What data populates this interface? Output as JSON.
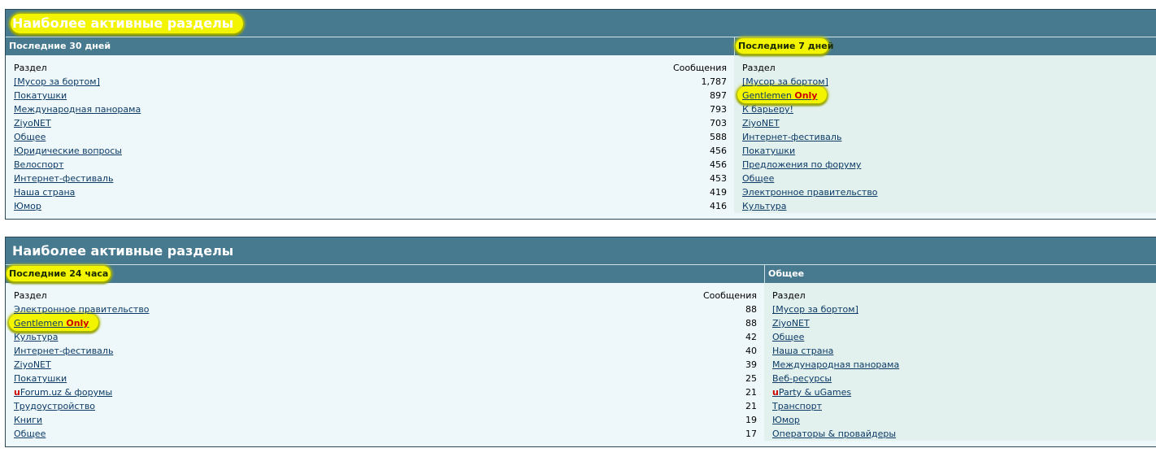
{
  "colors": {
    "header_bg": "#477a8f",
    "left_body_bg": "#eef8fa",
    "right_body_bg": "#e2f0ee",
    "link": "#0d3b66",
    "highlight": "#f3f500",
    "accent_red": "#cc0000"
  },
  "panels": [
    {
      "title": "Наиболее активные разделы",
      "left": {
        "header": "Последние 30 дней",
        "col_name": "Раздел",
        "col_count": "Сообщения",
        "rows": [
          {
            "prefix": "",
            "name": "[Мусор за бортом]",
            "suffix": "",
            "count": "1,787"
          },
          {
            "prefix": "",
            "name": "Покатушки",
            "suffix": "",
            "count": "897"
          },
          {
            "prefix": "",
            "name": "Международная панорама",
            "suffix": "",
            "count": "793"
          },
          {
            "prefix": "",
            "name": "ZiyoNET",
            "suffix": "",
            "count": "703"
          },
          {
            "prefix": "",
            "name": "Общее",
            "suffix": "",
            "count": "588"
          },
          {
            "prefix": "",
            "name": "Юридические вопросы",
            "suffix": "",
            "count": "456"
          },
          {
            "prefix": "",
            "name": "Велоспорт",
            "suffix": "",
            "count": "456"
          },
          {
            "prefix": "",
            "name": "Интернет-фестиваль",
            "suffix": "",
            "count": "453"
          },
          {
            "prefix": "",
            "name": "Наша страна",
            "suffix": "",
            "count": "419"
          },
          {
            "prefix": "",
            "name": "Юмор",
            "suffix": "",
            "count": "416"
          }
        ]
      },
      "right": {
        "header": "Последние 7 дней",
        "col_name": "Раздел",
        "rows": [
          {
            "prefix": "",
            "name": "[Мусор за бортом]",
            "suffix": ""
          },
          {
            "prefix": "",
            "name": "Gentlemen ",
            "suffix": "Only"
          },
          {
            "prefix": "",
            "name": "К барьеру!",
            "suffix": ""
          },
          {
            "prefix": "",
            "name": "ZiyoNET",
            "suffix": ""
          },
          {
            "prefix": "",
            "name": "Интернет-фестиваль",
            "suffix": ""
          },
          {
            "prefix": "",
            "name": "Покатушки",
            "suffix": ""
          },
          {
            "prefix": "",
            "name": "Предложения по форуму",
            "suffix": ""
          },
          {
            "prefix": "",
            "name": "Общее",
            "suffix": ""
          },
          {
            "prefix": "",
            "name": "Электронное правительство",
            "suffix": ""
          },
          {
            "prefix": "",
            "name": "Культура",
            "suffix": ""
          }
        ]
      }
    },
    {
      "title": "Наиболее активные разделы",
      "left": {
        "header": "Последние 24 часа",
        "col_name": "Раздел",
        "col_count": "Сообщения",
        "rows": [
          {
            "prefix": "",
            "name": "Электронное правительство",
            "suffix": "",
            "count": "88"
          },
          {
            "prefix": "",
            "name": "Gentlemen ",
            "suffix": "Only",
            "count": "88"
          },
          {
            "prefix": "",
            "name": "Культура",
            "suffix": "",
            "count": "42"
          },
          {
            "prefix": "",
            "name": "Интернет-фестиваль",
            "suffix": "",
            "count": "40"
          },
          {
            "prefix": "",
            "name": "ZiyoNET",
            "suffix": "",
            "count": "39"
          },
          {
            "prefix": "",
            "name": "Покатушки",
            "suffix": "",
            "count": "25"
          },
          {
            "prefix": "u",
            "name": "Forum.uz & форумы",
            "suffix": "",
            "count": "21"
          },
          {
            "prefix": "",
            "name": "Трудоустройство",
            "suffix": "",
            "count": "21"
          },
          {
            "prefix": "",
            "name": "Книги",
            "suffix": "",
            "count": "19"
          },
          {
            "prefix": "",
            "name": "Общее",
            "suffix": "",
            "count": "17"
          }
        ]
      },
      "right": {
        "header": "Общее",
        "col_name": "Раздел",
        "rows": [
          {
            "prefix": "",
            "name": "[Мусор за бортом]",
            "suffix": ""
          },
          {
            "prefix": "",
            "name": "ZiyoNET",
            "suffix": ""
          },
          {
            "prefix": "",
            "name": "Общее",
            "suffix": ""
          },
          {
            "prefix": "",
            "name": "Наша страна",
            "suffix": ""
          },
          {
            "prefix": "",
            "name": "Международная панорама",
            "suffix": ""
          },
          {
            "prefix": "",
            "name": "Веб-ресурсы",
            "suffix": ""
          },
          {
            "prefix": "u",
            "name": "Party & uGames",
            "suffix": ""
          },
          {
            "prefix": "",
            "name": "Транспорт",
            "suffix": ""
          },
          {
            "prefix": "",
            "name": "Юмор",
            "suffix": ""
          },
          {
            "prefix": "",
            "name": "Операторы & провайдеры",
            "suffix": ""
          }
        ]
      }
    }
  ]
}
